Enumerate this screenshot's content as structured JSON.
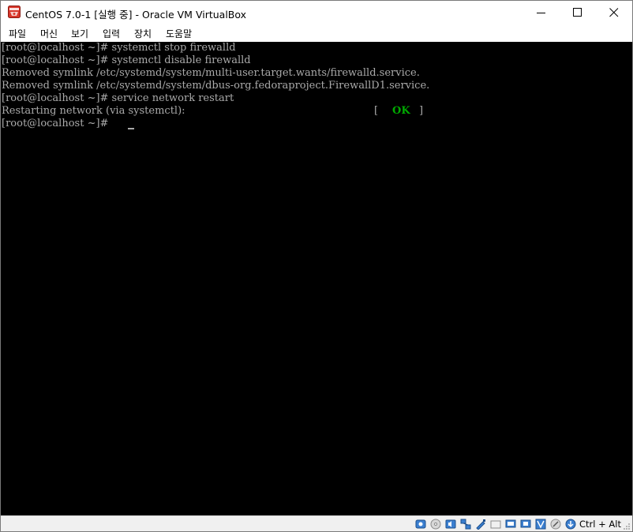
{
  "window": {
    "title": "CentOS 7.0-1 [실행 중] - Oracle VM VirtualBox",
    "controls": [
      "minimize",
      "maximize",
      "close"
    ]
  },
  "menu": {
    "items": [
      "파일",
      "머신",
      "보기",
      "입력",
      "장치",
      "도움말"
    ]
  },
  "console": {
    "lines": [
      "[root@localhost ~]# systemctl stop firewalld",
      "[root@localhost ~]# systemctl disable firewalld",
      "Removed symlink /etc/systemd/system/multi-user.target.wants/firewalld.service.",
      "Removed symlink /etc/systemd/system/dbus-org.fedoraproject.FirewallD1.service.",
      "[root@localhost ~]# service network restart",
      "Restarting network (via systemctl):",
      "[root@localhost ~]# "
    ],
    "status_open": "[",
    "status_ok": "OK",
    "status_close": "]",
    "ok_color": "#00aa00",
    "text_color": "#aaaaaa",
    "background": "#000000"
  },
  "statusbar": {
    "icons": [
      "hard-disk-icon",
      "optical-drive-icon",
      "audio-icon",
      "network-icon",
      "usb-icon",
      "shared-folders-icon",
      "display-icon",
      "video-capture-icon",
      "virtualization-icon",
      "mouse-integration-icon",
      "keyboard-capture-icon"
    ],
    "host_key": "Ctrl + Alt"
  }
}
